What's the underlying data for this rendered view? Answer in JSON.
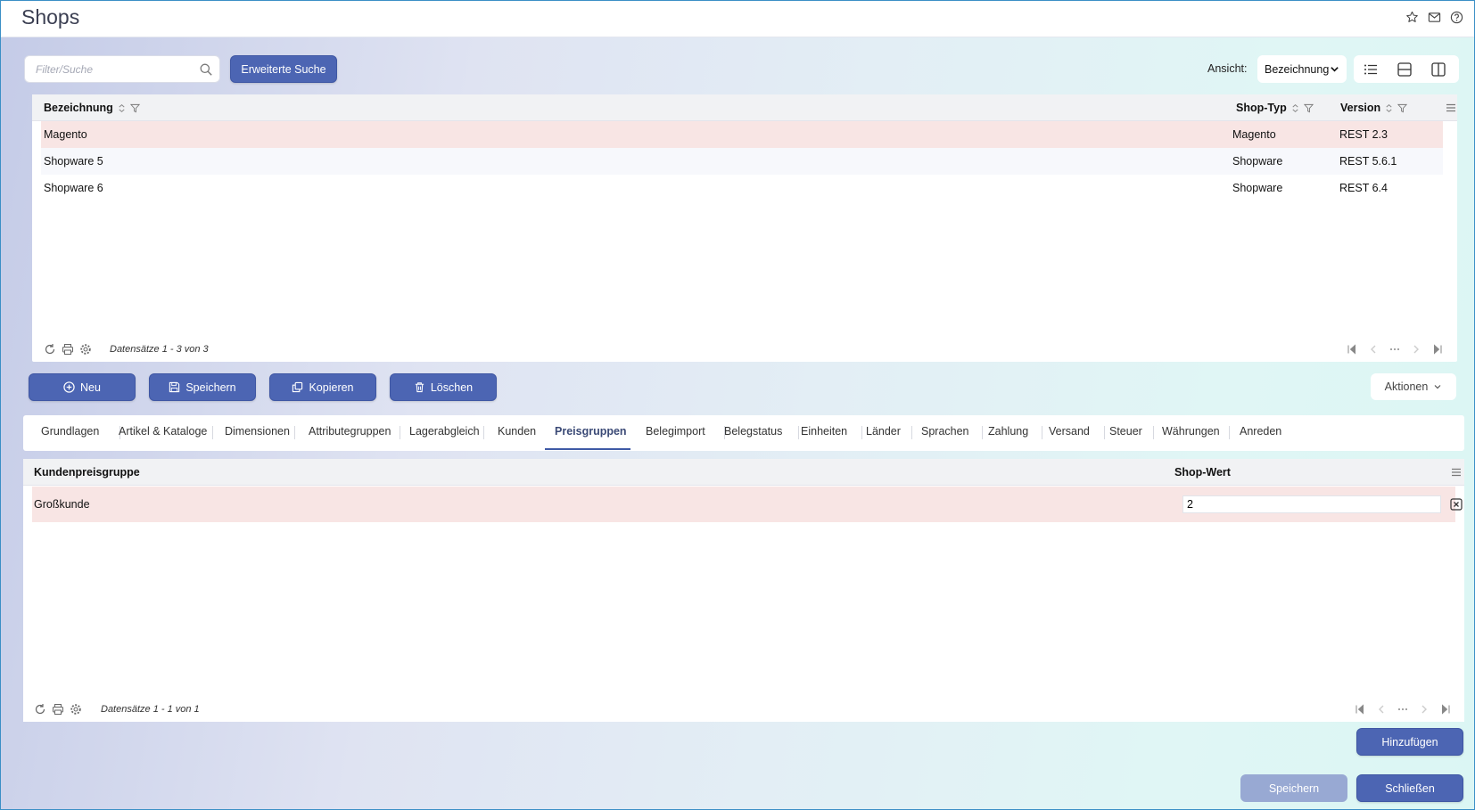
{
  "app": {
    "title": "Shops"
  },
  "top_icons": [
    "star-icon",
    "mail-icon",
    "help-icon"
  ],
  "search": {
    "placeholder": "Filter/Suche",
    "value": "",
    "advanced_label": "Erweiterte Suche"
  },
  "view": {
    "label": "Ansicht:",
    "selected": "Bezeichnung"
  },
  "shops_grid": {
    "columns": [
      "Bezeichnung",
      "Shop-Typ",
      "Version"
    ],
    "rows": [
      {
        "bezeichnung": "Magento",
        "shop_typ": "Magento",
        "version": "REST 2.3",
        "selected": true
      },
      {
        "bezeichnung": "Shopware 5",
        "shop_typ": "Shopware",
        "version": "REST 5.6.1",
        "selected": false
      },
      {
        "bezeichnung": "Shopware 6",
        "shop_typ": "Shopware",
        "version": "REST 6.4",
        "selected": false
      }
    ],
    "record_count": "Datensätze 1 - 3 von 3"
  },
  "toolbar": {
    "new_label": "Neu",
    "save_label": "Speichern",
    "copy_label": "Kopieren",
    "delete_label": "Löschen",
    "actions_label": "Aktionen"
  },
  "tabs": [
    {
      "label": "Grundlagen",
      "active": false
    },
    {
      "label": "Artikel & Kataloge",
      "active": false
    },
    {
      "label": "Dimensionen",
      "active": false
    },
    {
      "label": "Attributegruppen",
      "active": false
    },
    {
      "label": "Lagerabgleich",
      "active": false
    },
    {
      "label": "Kunden",
      "active": false
    },
    {
      "label": "Preisgruppen",
      "active": true
    },
    {
      "label": "Belegimport",
      "active": false
    },
    {
      "label": "Belegstatus",
      "active": false
    },
    {
      "label": "Einheiten",
      "active": false
    },
    {
      "label": "Länder",
      "active": false
    },
    {
      "label": "Sprachen",
      "active": false
    },
    {
      "label": "Zahlung",
      "active": false
    },
    {
      "label": "Versand",
      "active": false
    },
    {
      "label": "Steuer",
      "active": false
    },
    {
      "label": "Währungen",
      "active": false
    },
    {
      "label": "Anreden",
      "active": false
    }
  ],
  "price_grid": {
    "columns": [
      "Kundenpreisgruppe",
      "Shop-Wert"
    ],
    "rows": [
      {
        "gruppe": "Großkunde",
        "wert": "2"
      }
    ],
    "record_count": "Datensätze 1 - 1 von 1"
  },
  "footer": {
    "add_label": "Hinzufügen",
    "save_label": "Speichern",
    "close_label": "Schließen"
  }
}
